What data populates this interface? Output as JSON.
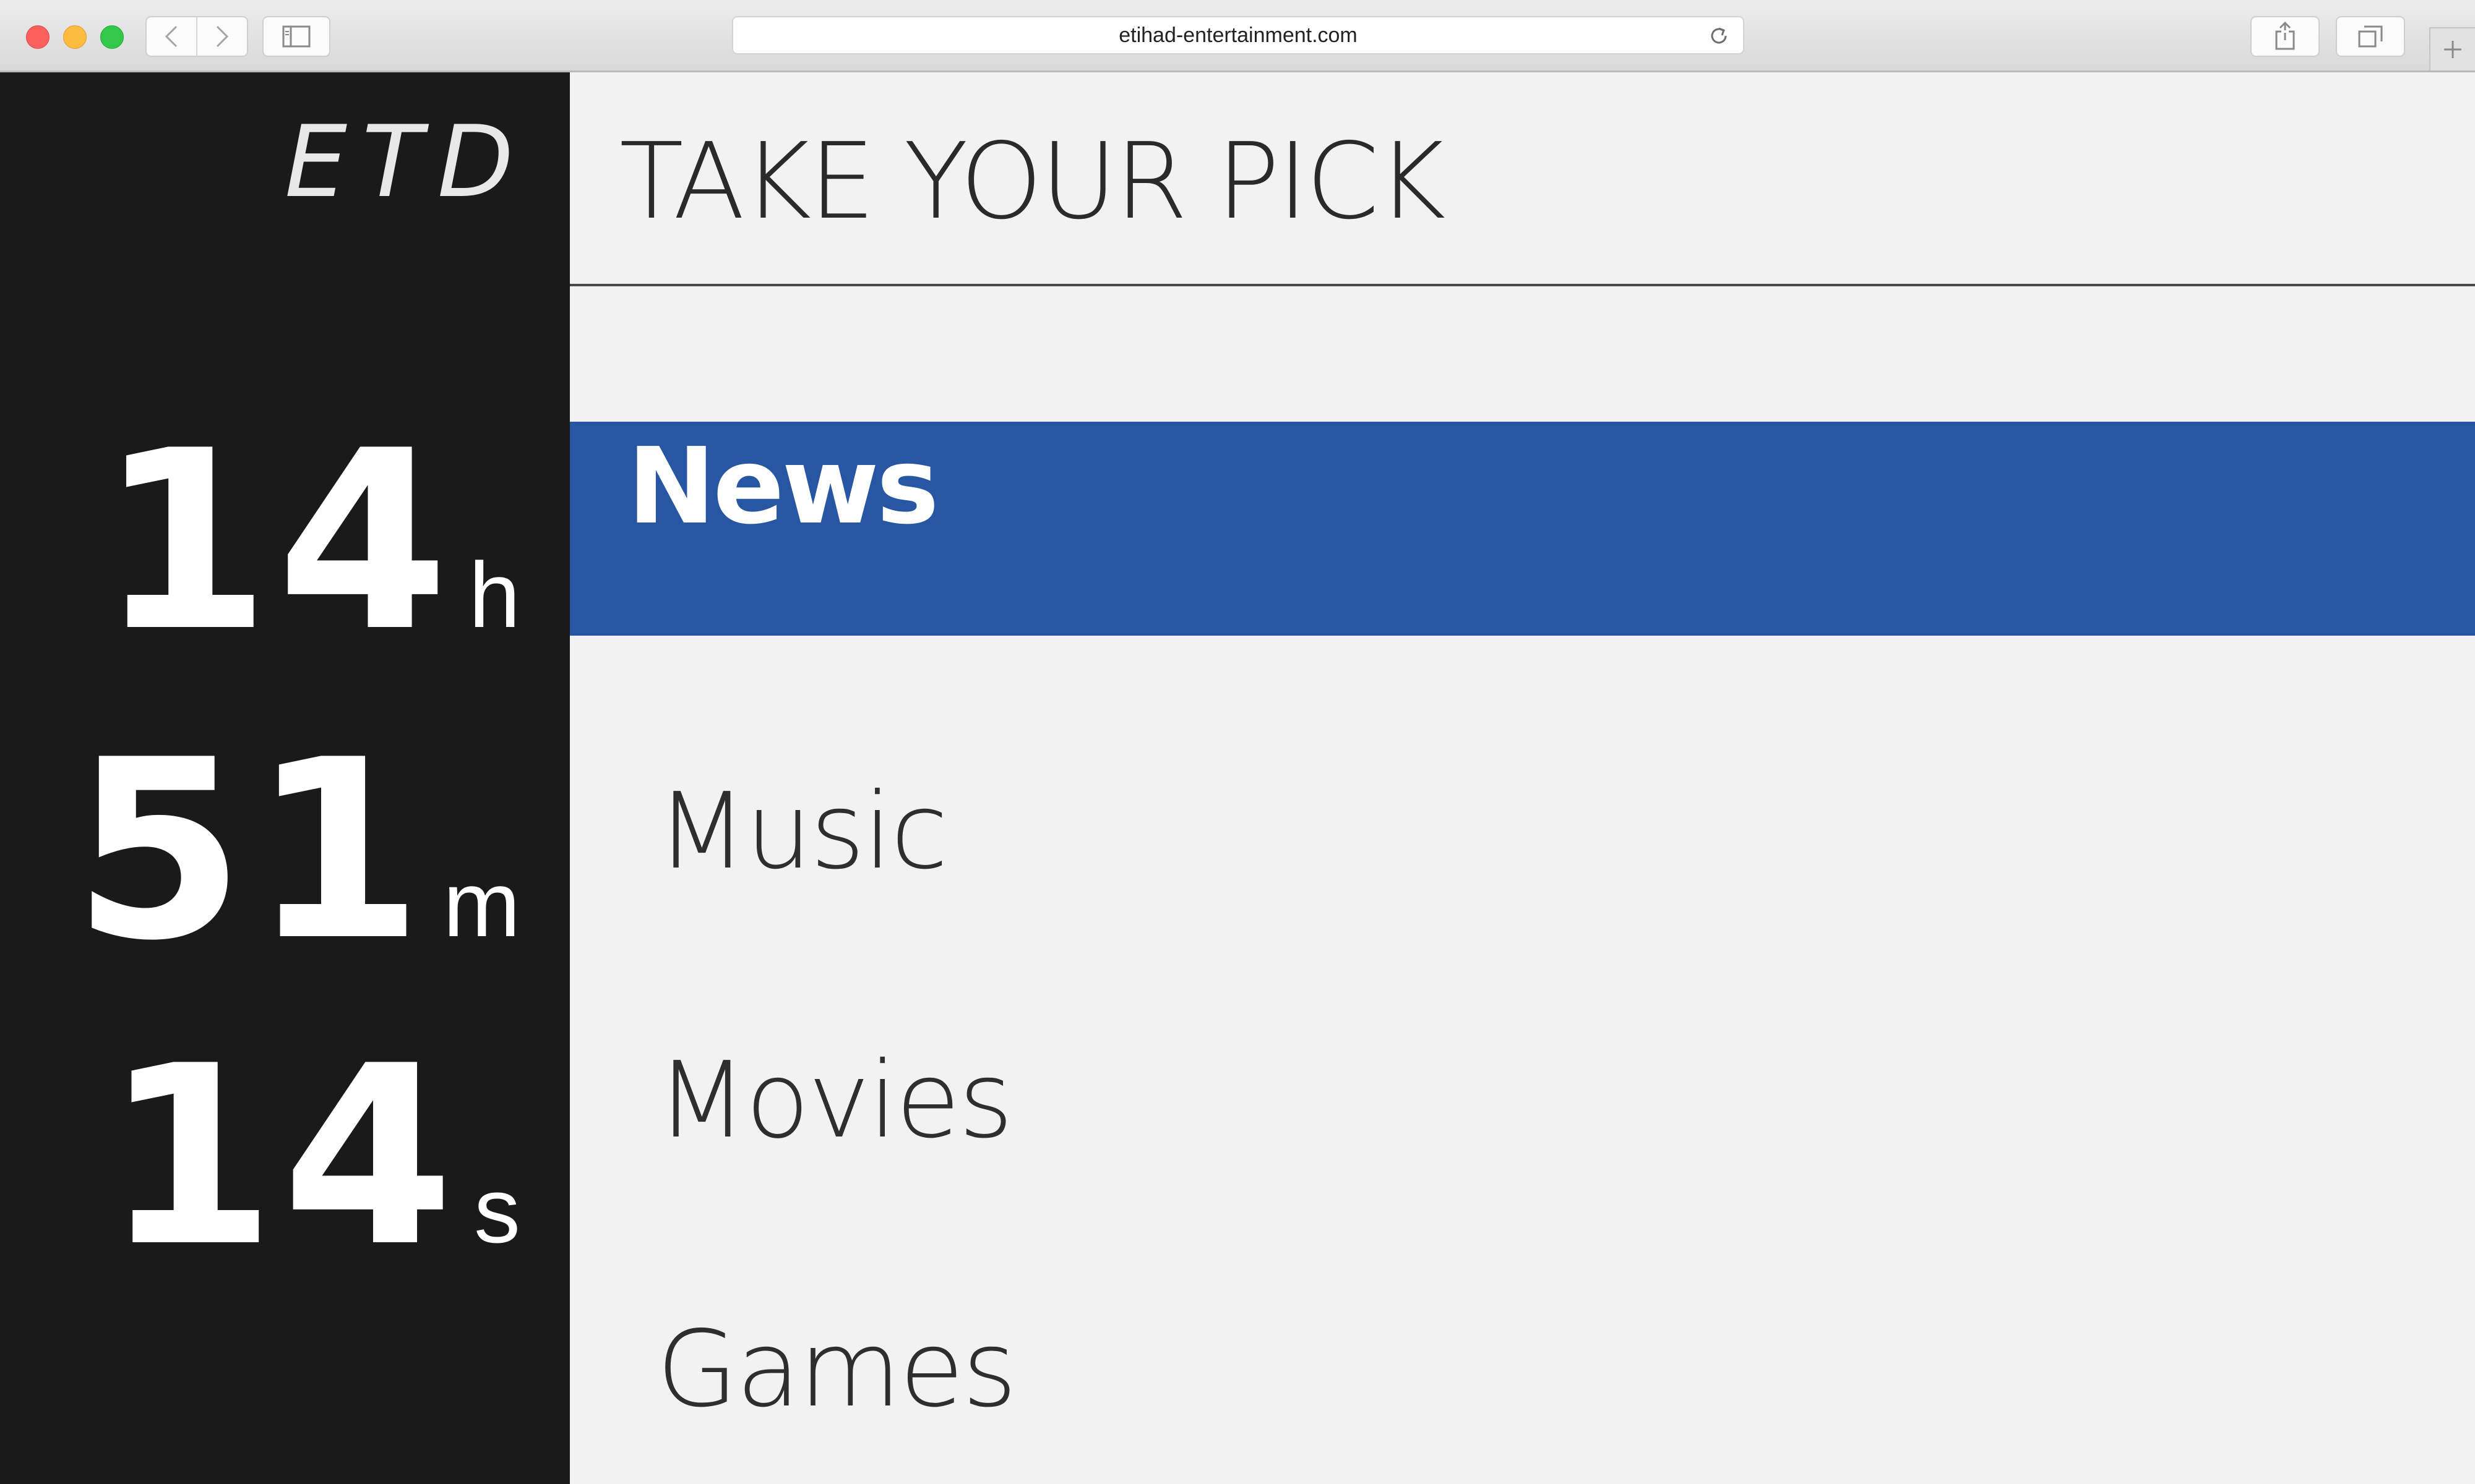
{
  "browser": {
    "url": "etihad-entertainment.com",
    "icons": {
      "back": "chevron-left-icon",
      "forward": "chevron-right-icon",
      "sidebar": "sidebar-icon",
      "reload": "reload-icon",
      "share": "share-icon",
      "tabs": "tabs-icon",
      "new_tab": "plus-icon"
    }
  },
  "sidebar": {
    "logo": "ETD",
    "timer": {
      "hours": "14",
      "hours_unit": "h",
      "minutes": "51",
      "minutes_unit": "m",
      "seconds": "14",
      "seconds_unit": "s"
    }
  },
  "main": {
    "title": "TAKE YOUR PICK",
    "menu": [
      {
        "label": "News",
        "active": true
      },
      {
        "label": "Music",
        "active": false
      },
      {
        "label": "Movies",
        "active": false
      },
      {
        "label": "Games",
        "active": false
      }
    ]
  },
  "colors": {
    "sidebar_bg": "#1a1a1a",
    "accent": "#2756a2",
    "content_bg": "#f2f2f2"
  }
}
